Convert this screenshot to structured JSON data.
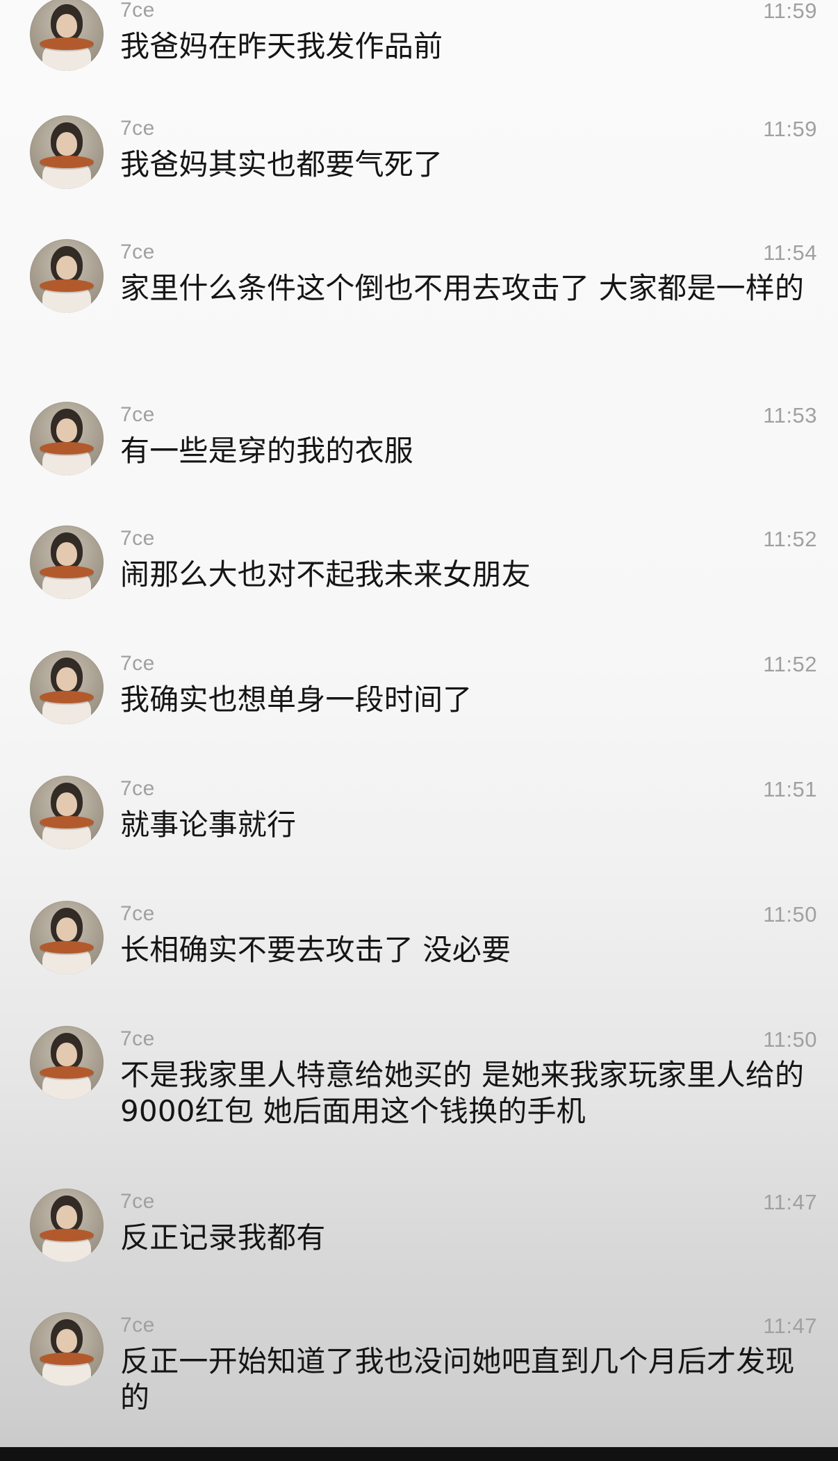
{
  "messages": [
    {
      "name": "7ce",
      "time": "11:59",
      "text": "我爸妈在昨天我发作品前"
    },
    {
      "name": "7ce",
      "time": "11:59",
      "text": "我爸妈其实也都要气死了"
    },
    {
      "name": "7ce",
      "time": "11:54",
      "text": "家里什么条件这个倒也不用去攻击了 大家都是一样的"
    },
    {
      "name": "7ce",
      "time": "11:53",
      "text": "有一些是穿的我的衣服"
    },
    {
      "name": "7ce",
      "time": "11:52",
      "text": "闹那么大也对不起我未来女朋友"
    },
    {
      "name": "7ce",
      "time": "11:52",
      "text": "我确实也想单身一段时间了"
    },
    {
      "name": "7ce",
      "time": "11:51",
      "text": "就事论事就行"
    },
    {
      "name": "7ce",
      "time": "11:50",
      "text": "长相确实不要去攻击了 没必要"
    },
    {
      "name": "7ce",
      "time": "11:50",
      "text": "不是我家里人特意给她买的 是她来我家玩家里人给的9000红包 她后面用这个钱换的手机"
    },
    {
      "name": "7ce",
      "time": "11:47",
      "text": "反正记录我都有"
    },
    {
      "name": "7ce",
      "time": "11:47",
      "text": "反正一开始知道了我也没问她吧直到几个月后才发现的"
    }
  ],
  "avatar_icon": "user-avatar-icon"
}
